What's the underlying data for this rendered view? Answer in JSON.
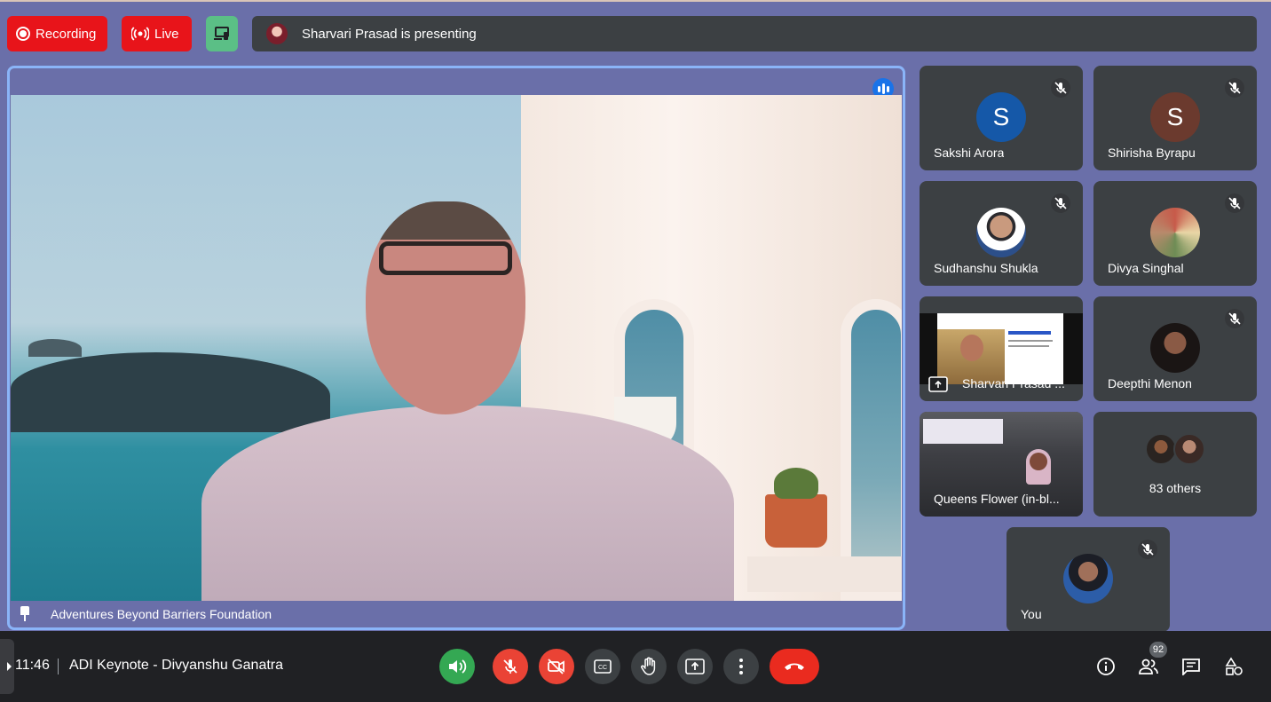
{
  "top_bar": {
    "recording_label": "Recording",
    "live_label": "Live",
    "presenting_text": "Sharvari Prasad is presenting"
  },
  "main_stage": {
    "caption": "Adventures Beyond Barriers Foundation"
  },
  "participants": [
    {
      "name": "Sakshi Arora",
      "initial": "S",
      "avatar_color": "#1558a8",
      "muted": true
    },
    {
      "name": "Shirisha Byrapu",
      "initial": "S",
      "avatar_color": "#6b3a2e",
      "muted": true
    },
    {
      "name": "Sudhanshu Shukla",
      "muted": true
    },
    {
      "name": "Divya Singhal",
      "muted": true
    },
    {
      "name": "Sharvari Prasad ...",
      "presenting": true
    },
    {
      "name": "Deepthi Menon",
      "muted": true
    },
    {
      "name": "Queens Flower (in-bl..."
    },
    {
      "others_label": "83 others"
    },
    {
      "name": "You",
      "muted": true
    }
  ],
  "bottom_bar": {
    "time": "11:46",
    "meeting_title": "ADI Keynote - Divyanshu Ganatra",
    "people_count": "92"
  },
  "colors": {
    "background": "#6a6fa9",
    "recording_red": "#e8141a",
    "tile_bg": "#3c4043",
    "active_speaker_border": "#8ab4f8",
    "control_red": "#ea4335",
    "control_green": "#34a853"
  },
  "icons": [
    "record-icon",
    "live-broadcast-icon",
    "cast-icon",
    "speaking-indicator-icon",
    "pin-icon",
    "mic-off-icon",
    "present-screen-icon",
    "volume-icon",
    "camera-off-icon",
    "captions-icon",
    "raise-hand-icon",
    "present-now-icon",
    "more-options-icon",
    "end-call-icon",
    "info-icon",
    "people-icon",
    "chat-icon",
    "activities-icon"
  ]
}
